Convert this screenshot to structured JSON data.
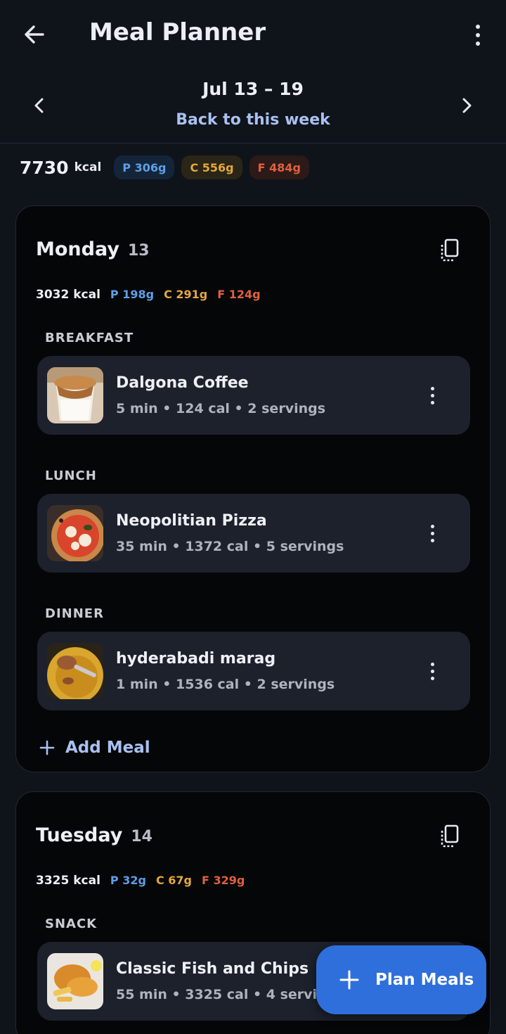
{
  "app": {
    "title": "Meal Planner"
  },
  "week": {
    "range": "Jul 13 – 19",
    "back_to_week": "Back to this week"
  },
  "summary": {
    "kcal_value": "7730",
    "kcal_unit": "kcal",
    "protein": "P 306g",
    "carbs": "C 556g",
    "fat": "F 484g"
  },
  "colors": {
    "protein": "#5e9fe8",
    "carbs": "#e5a83c",
    "fat": "#e0603f",
    "accent": "#2f6fdc",
    "link": "#a9c1ef"
  },
  "days": [
    {
      "name": "Monday",
      "date": "13",
      "kcal": "3032 kcal",
      "protein": "P 198g",
      "carbs": "C 291g",
      "fat": "F 124g",
      "sections": [
        {
          "label": "BREAKFAST",
          "meal": {
            "name": "Dalgona Coffee",
            "meta": "5 min • 124 cal • 2 servings"
          }
        },
        {
          "label": "LUNCH",
          "meal": {
            "name": "Neopolitian Pizza",
            "meta": "35 min • 1372 cal • 5 servings"
          }
        },
        {
          "label": "DINNER",
          "meal": {
            "name": "hyderabadi marag",
            "meta": "1 min • 1536 cal • 2 servings"
          }
        }
      ],
      "add_meal": "Add Meal"
    },
    {
      "name": "Tuesday",
      "date": "14",
      "kcal": "3325 kcal",
      "protein": "P 32g",
      "carbs": "C 67g",
      "fat": "F 329g",
      "sections": [
        {
          "label": "SNACK",
          "meal": {
            "name": "Classic Fish and Chips",
            "meta": "55 min • 3325 cal • 4 servings"
          }
        }
      ]
    }
  ],
  "fab": {
    "label": "Plan Meals"
  },
  "icons": {
    "back": "arrow-left-icon",
    "more": "more-vert-icon",
    "prev": "chevron-left-icon",
    "next": "chevron-right-icon",
    "copy": "copy-icon",
    "add": "plus-icon"
  }
}
